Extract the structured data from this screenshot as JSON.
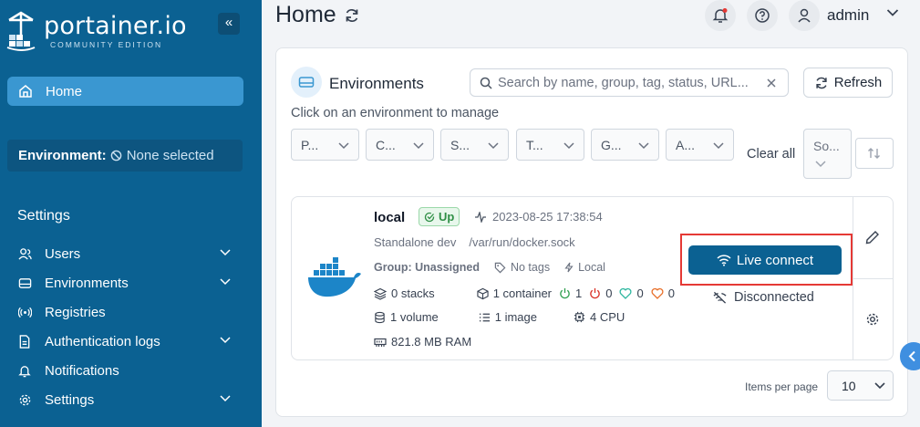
{
  "sidebar": {
    "logo_title": "portainer.io",
    "logo_subtitle": "COMMUNITY EDITION",
    "collapse_glyph": "«",
    "home_label": "Home",
    "environment_label": "Environment:",
    "environment_value": "None selected",
    "settings_heading": "Settings",
    "items": [
      {
        "label": "Users",
        "icon": "users-icon",
        "has_chevron": true
      },
      {
        "label": "Environments",
        "icon": "environments-icon",
        "has_chevron": true
      },
      {
        "label": "Registries",
        "icon": "registries-icon",
        "has_chevron": false
      },
      {
        "label": "Authentication logs",
        "icon": "file-icon",
        "has_chevron": true
      },
      {
        "label": "Notifications",
        "icon": "bell-icon",
        "has_chevron": false
      },
      {
        "label": "Settings",
        "icon": "gear-icon",
        "has_chevron": true
      }
    ]
  },
  "header": {
    "title": "Home",
    "user": "admin"
  },
  "environments": {
    "title": "Environments",
    "search_placeholder": "Search by name, group, tag, status, URL...",
    "refresh_label": "Refresh",
    "hint": "Click on an environment to manage",
    "filters": [
      "P...",
      "C...",
      "S...",
      "T...",
      "G...",
      "A..."
    ],
    "clear_all": "Clear all",
    "sort_label": "So..."
  },
  "item": {
    "name": "local",
    "status": "Up",
    "timestamp": "2023-08-25 17:38:54",
    "type": "Standalone dev",
    "socket": "/var/run/docker.sock",
    "group": "Group: Unassigned",
    "tags": "No tags",
    "location": "Local",
    "stacks": "0 stacks",
    "containers": "1 container",
    "running": "1",
    "stopped": "0",
    "healthy": "0",
    "unhealthy": "0",
    "volumes": "1 volume",
    "images": "1 image",
    "cpu": "4 CPU",
    "ram": "821.8 MB RAM",
    "live_connect": "Live connect",
    "connection_status": "Disconnected"
  },
  "pagination": {
    "label": "Items per page",
    "value": "10"
  },
  "colors": {
    "sidebar_bg": "#0b6192",
    "accent": "#3a97d1",
    "highlight_frame": "#e53935",
    "status_up": "#2f8f46"
  }
}
